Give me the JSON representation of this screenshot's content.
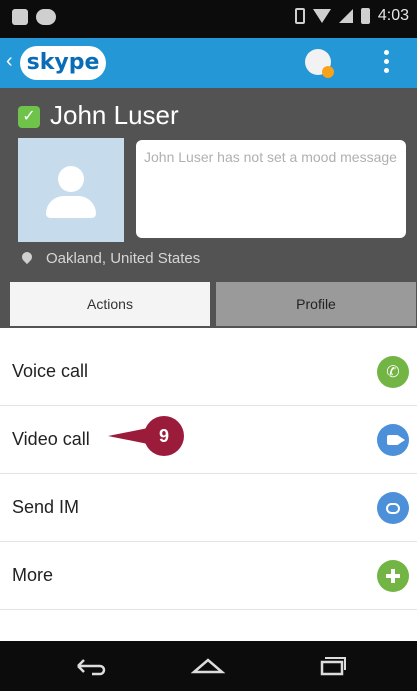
{
  "status_bar": {
    "time": "4:03"
  },
  "app_bar": {
    "logo_text": "skype",
    "accent_color": "#2497d6",
    "presence_color": "#f7a21b"
  },
  "contact": {
    "name": "John Luser",
    "mood_message": "John Luser has not set a mood message",
    "location": "Oakland, United States"
  },
  "tabs": [
    {
      "label": "Actions",
      "selected": true
    },
    {
      "label": "Profile",
      "selected": false
    }
  ],
  "actions": [
    {
      "label": "Voice call",
      "icon": "phone-icon",
      "color": "#72b544"
    },
    {
      "label": "Video call",
      "icon": "video-icon",
      "color": "#4b90d8"
    },
    {
      "label": "Send IM",
      "icon": "chat-icon",
      "color": "#4b90d8"
    },
    {
      "label": "More",
      "icon": "plus-icon",
      "color": "#72b544"
    }
  ],
  "callout": {
    "number": "9",
    "color": "#9b1c3a"
  },
  "nav": {
    "back": "back-icon",
    "home": "home-icon",
    "recent": "recent-apps-icon"
  }
}
